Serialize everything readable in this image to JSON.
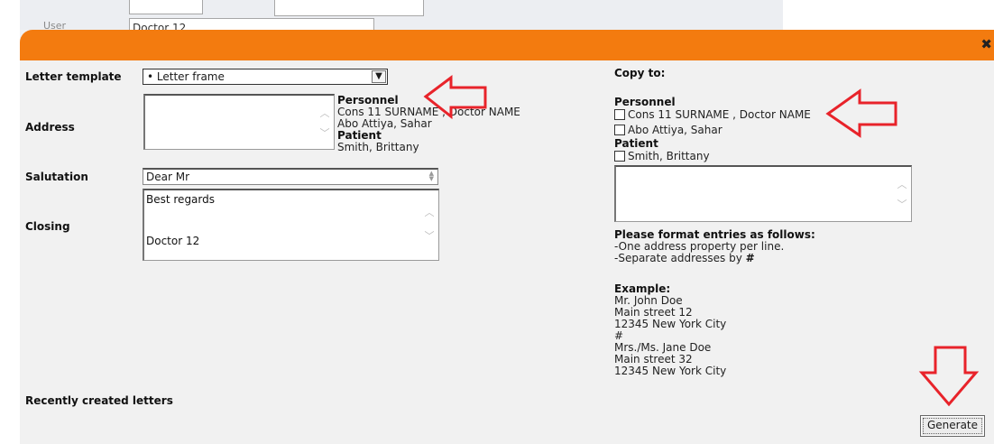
{
  "background": {
    "user_label": "User",
    "user_value": "Doctor 12"
  },
  "dialog": {
    "close_icon": "close-icon",
    "letter_template_label": "Letter template",
    "letter_template_value": "• Letter frame",
    "address_label": "Address",
    "salutation_label": "Salutation",
    "salutation_value": "Dear Mr",
    "closing_label": "Closing",
    "closing_line1": "Best regards",
    "closing_line2": "Doctor 12",
    "info": {
      "personnel_heading": "Personnel",
      "personnel_1": "Cons 11 SURNAME , Doctor NAME",
      "personnel_2": "Abo Attiya, Sahar",
      "patient_heading": "Patient",
      "patient_1": "Smith, Brittany"
    },
    "recent_label": "Recently created letters",
    "copy_to": {
      "label": "Copy to:",
      "personnel_heading": "Personnel",
      "personnel_1": "Cons 11 SURNAME , Doctor NAME",
      "personnel_2": "Abo Attiya, Sahar",
      "patient_heading": "Patient",
      "patient_1": "Smith, Brittany"
    },
    "format": {
      "heading": "Please format entries as follows:",
      "line1": "-One address property per line.",
      "line2_prefix": "-Separate addresses by ",
      "line2_hash": "#",
      "example_heading": "Example:",
      "example_lines": [
        "Mr. John Doe",
        "Main street 12",
        "12345 New York City",
        "#",
        "Mrs./Ms. Jane Doe",
        "Main street 32",
        "12345 New York City"
      ]
    },
    "generate_label": "Generate"
  },
  "colors": {
    "titlebar": "#f37b0f",
    "dialog_bg": "#f1f1f1",
    "annotation_arrow": "#e8232a"
  }
}
